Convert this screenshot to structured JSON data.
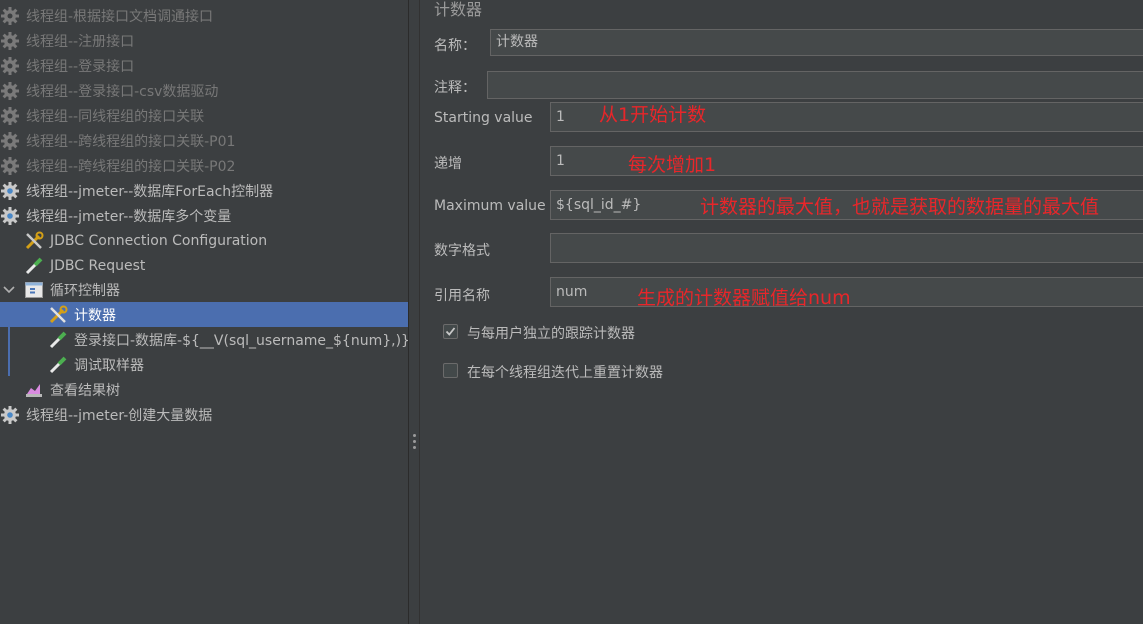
{
  "tree": {
    "items": [
      {
        "label": "线程组-根据接口文档调通接口",
        "icon": "gear-icon"
      },
      {
        "label": "线程组--注册接口",
        "icon": "gear-icon"
      },
      {
        "label": "线程组--登录接口",
        "icon": "gear-icon"
      },
      {
        "label": "线程组--登录接口-csv数据驱动",
        "icon": "gear-icon"
      },
      {
        "label": "线程组--同线程组的接口关联",
        "icon": "gear-icon"
      },
      {
        "label": "线程组--跨线程组的接口关联-P01",
        "icon": "gear-icon"
      },
      {
        "label": "线程组--跨线程组的接口关联-P02",
        "icon": "gear-icon"
      },
      {
        "label": "线程组--jmeter--数据库ForEach控制器",
        "icon": "gear-icon"
      },
      {
        "label": "线程组--jmeter--数据库多个变量",
        "icon": "gear-icon"
      },
      {
        "label": "JDBC Connection Configuration",
        "icon": "wrench-icon"
      },
      {
        "label": "JDBC Request",
        "icon": "pipette-icon"
      },
      {
        "label": "循环控制器",
        "icon": "loop-controller-icon"
      },
      {
        "label": "计数器",
        "icon": "wrench-icon"
      },
      {
        "label": "登录接口-数据库-${__V(sql_username_${num},)}",
        "icon": "pipette-icon"
      },
      {
        "label": "调试取样器",
        "icon": "pipette-icon"
      },
      {
        "label": "查看结果树",
        "icon": "chart-icon"
      },
      {
        "label": "线程组--jmeter-创建大量数据",
        "icon": "gear-icon"
      }
    ]
  },
  "panel": {
    "title": "计数器",
    "name_label": "名称：",
    "name_value": "计数器",
    "comment_label": "注释：",
    "comment_value": "",
    "start_label": "Starting value",
    "start_value": "1",
    "increment_label": "递增",
    "increment_value": "1",
    "max_label": "Maximum value",
    "max_value": "${sql_id_#}",
    "format_label": "数字格式",
    "format_value": "",
    "ref_label": "引用名称",
    "ref_value": "num",
    "cb1_label": "与每用户独立的跟踪计数器",
    "cb1_checked": true,
    "cb2_label": "在每个线程组迭代上重置计数器",
    "cb2_checked": false
  },
  "annotations": {
    "start": "从1开始计数",
    "increment": "每次增加1",
    "max": "计数器的最大值，也就是获取的数据量的最大值",
    "ref": "生成的计数器赋值给num"
  },
  "colors": {
    "background": "#3c3f41",
    "selection": "#4b6eaf",
    "annotation": "#e8262a",
    "field_bg": "#45494a"
  }
}
